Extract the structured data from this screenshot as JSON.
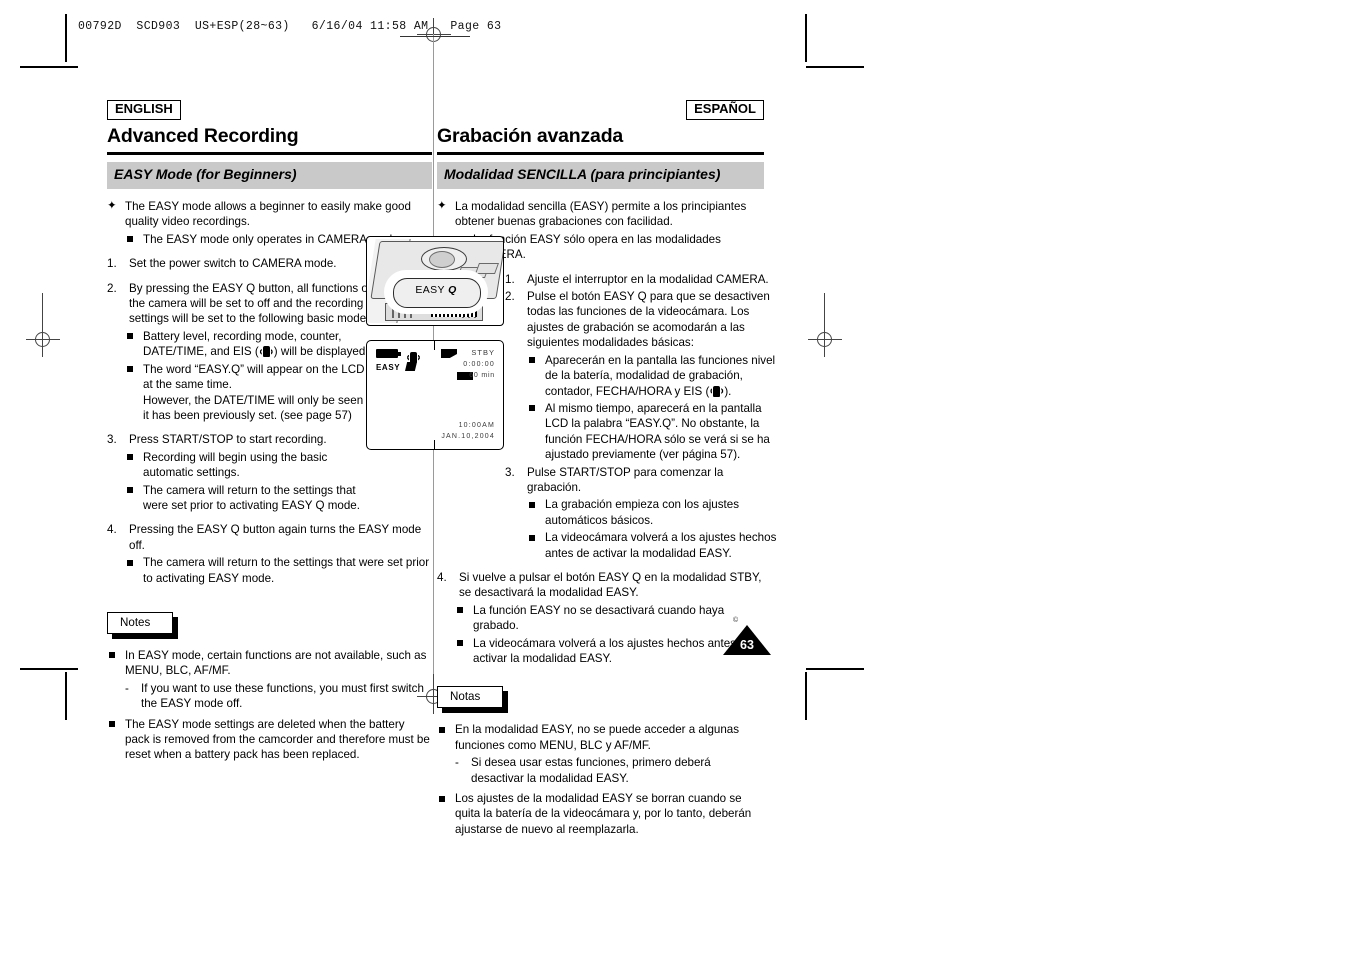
{
  "print_slug": "00792D  SCD903  US+ESP(28~63)   6/16/04 11:58 AM   Page 63",
  "page_number": "63",
  "english": {
    "lang_tag": "ENGLISH",
    "title": "Advanced Recording",
    "section_heading": "EASY Mode (for Beginners)",
    "intro": "The EASY mode allows a beginner to easily make good quality video recordings.",
    "intro_sub": "The EASY mode only operates in CAMERA mode.",
    "step1": "Set the power switch to CAMERA mode.",
    "step2": "By pressing the EASY Q button, all functions on the camera will be set to off and the recording settings will be set to the following basic modes:",
    "step2_sub1_a": "Battery level, recording mode, counter, DATE/TIME, and EIS (",
    "step2_sub1_b": ") will be displayed.",
    "step2_sub2": "The word “EASY.Q” will appear on the LCD at the same time.",
    "step2_sub2_cont": "However, the DATE/TIME will only be seen if it has been previously set. (see page 57)",
    "step3": "Press START/STOP to start recording.",
    "step3_sub1": "Recording will begin using the basic automatic settings.",
    "step3_sub2": "The camera will return to the settings that were set prior to activating EASY Q mode.",
    "step4": "Pressing the EASY Q button again turns the EASY mode off.",
    "step4_sub1": "The camera will return to the settings that were set prior to activating EASY mode.",
    "notes_label": "Notes",
    "note1": "In EASY mode, certain functions are not available, such as MENU, BLC, AF/MF.",
    "note1_dash": "If you want to use these functions, you must first switch the EASY mode off.",
    "note2": "The EASY mode settings are deleted when the battery pack is removed from the camcorder and therefore must be reset when a battery pack has been replaced."
  },
  "spanish": {
    "lang_tag": "ESPAÑOL",
    "title": "Grabación avanzada",
    "section_heading": "Modalidad SENCILLA (para principiantes)",
    "intro": "La modalidad sencilla (EASY) permite a los principiantes obtener buenas grabaciones con facilidad.",
    "intro_sub": "La función EASY sólo opera en las modalidades CAMERA.",
    "step1": "Ajuste el interruptor en la modalidad CAMERA.",
    "step2": "Pulse el botón EASY Q para que se desactiven todas las funciones de la videocámara. Los ajustes de grabación se acomodarán a las siguientes modalidades básicas:",
    "step2_sub1_a": "Aparecerán en la pantalla las funciones nivel de la batería, modalidad de grabación, contador, FECHA/HORA y EIS (",
    "step2_sub1_b": ").",
    "step2_sub2": "Al mismo tiempo, aparecerá en la pantalla LCD la palabra “EASY.Q”. No obstante, la función FECHA/HORA sólo se verá si se ha ajustado previamente (ver página 57).",
    "step3": "Pulse START/STOP para comenzar la grabación.",
    "step3_sub1": "La grabación empieza con los ajustes automáticos básicos.",
    "step3_sub2": "La videocámara volverá a los ajustes hechos antes de activar la modalidad EASY.",
    "step4": "Si vuelve a pulsar el botón EASY Q en la modalidad STBY, se desactivará la modalidad EASY.",
    "step4_sub1": "La función EASY no se desactivará cuando haya grabado.",
    "step4_sub2": "La videocámara volverá a los ajustes hechos antes de activar la modalidad EASY.",
    "notes_label": "Notas",
    "note1": "En la modalidad EASY, no se puede acceder a algunas funciones como MENU, BLC y AF/MF.",
    "note1_dash": "Si desea usar estas funciones, primero deberá desactivar la modalidad EASY.",
    "note2": "Los ajustes de la modalidad EASY se borran cuando se quita la batería de la videocámara y, por lo tanto, deberán ajustarse de nuevo al reemplazarla."
  },
  "illustration": {
    "camera_button_label": "EASY",
    "camera_button_q": "Q",
    "lcd": {
      "easy_label": "EASY",
      "stby": "STBY",
      "timecode": "0:00:00",
      "remaining": "60 min",
      "time": "10:00AM",
      "date": "JAN.10,2004"
    }
  },
  "markers": {
    "bullet_flower": "✦",
    "dash": "-",
    "num1": "1.",
    "num2": "2.",
    "num3": "3.",
    "num4": "4."
  },
  "colors": {
    "section_bar": "#c9c9c9",
    "rule": "#000000",
    "page_badge": "#000000"
  }
}
